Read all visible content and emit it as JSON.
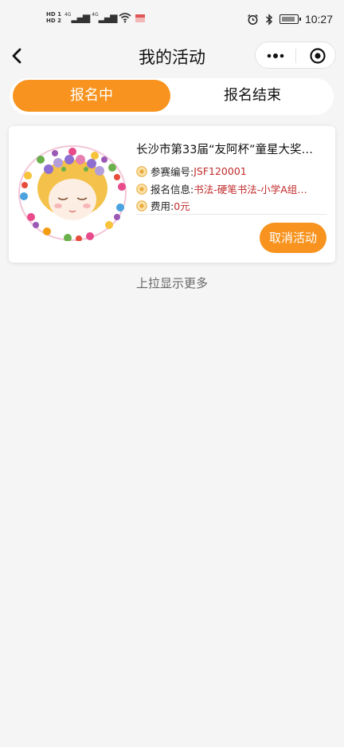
{
  "status_bar": {
    "hd1": "HD 1",
    "hd2": "HD 2",
    "net1": "4G",
    "net2": "4G",
    "time": "10:27"
  },
  "nav": {
    "title": "我的活动"
  },
  "tabs": [
    {
      "label": "报名中",
      "active": true
    },
    {
      "label": "报名结束",
      "active": false
    }
  ],
  "activity": {
    "title": "长沙市第33届“友阿杯”童星大奖…",
    "fields": [
      {
        "label": "参赛编号:",
        "value": "JSF120001"
      },
      {
        "label": "报名信息:",
        "value": "书法-硬笔书法-小学A组…"
      },
      {
        "label": "费用:",
        "value": "0元"
      }
    ],
    "cancel_label": "取消活动"
  },
  "footer": {
    "load_more": "上拉显示更多"
  },
  "colors": {
    "accent": "#f7931e",
    "value_red": "#c12a2a",
    "background": "#f5f5f5"
  }
}
